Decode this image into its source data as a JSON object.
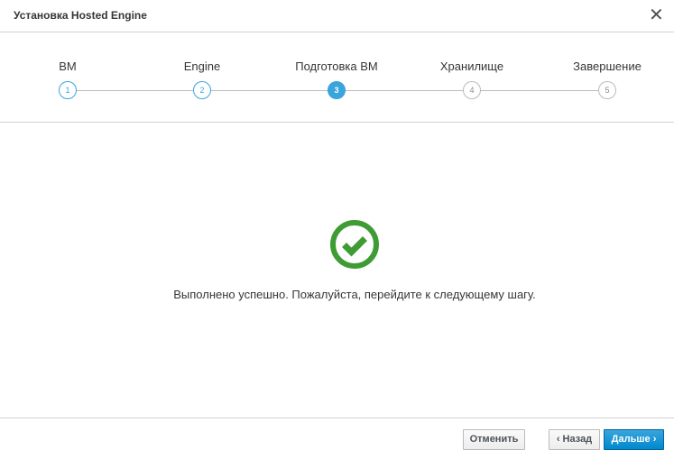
{
  "dialog": {
    "title": "Установка Hosted Engine",
    "close_glyph": "✕"
  },
  "steps": [
    {
      "label": "ВМ",
      "number": "1",
      "state": "done"
    },
    {
      "label": "Engine",
      "number": "2",
      "state": "done"
    },
    {
      "label": "Подготовка ВМ",
      "number": "3",
      "state": "active"
    },
    {
      "label": "Хранилище",
      "number": "4",
      "state": "pending"
    },
    {
      "label": "Завершение",
      "number": "5",
      "state": "pending"
    }
  ],
  "content": {
    "status_icon": "check-circle-icon",
    "status_color": "#3f9c35",
    "message": "Выполнено успешно. Пожалуйста, перейдите к следующему шагу."
  },
  "footer": {
    "cancel_label": "Отменить",
    "back_label": "Назад",
    "back_chevron": "‹",
    "next_label": "Дальше",
    "next_chevron": "›"
  },
  "colors": {
    "accent": "#39a5dc",
    "primary": "#0088ce",
    "success": "#3f9c35"
  }
}
